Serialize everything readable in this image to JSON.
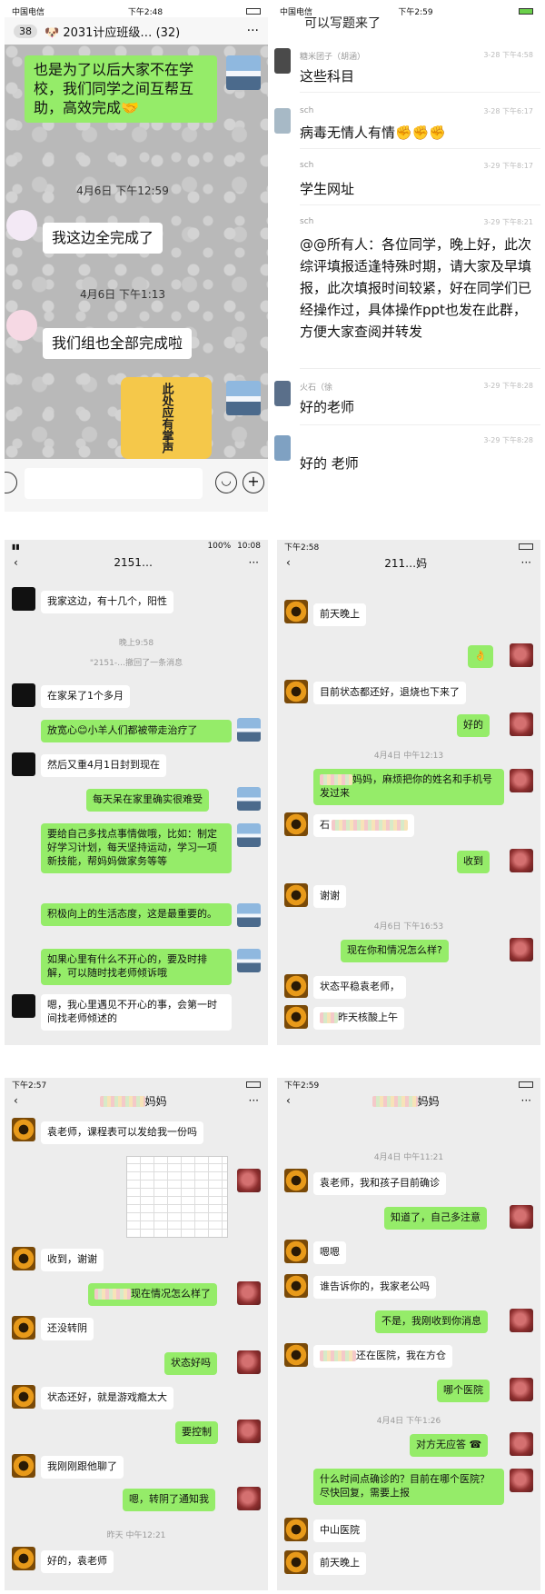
{
  "p1": {
    "status": {
      "carrier": "中国电信",
      "time": "下午2:48"
    },
    "header": {
      "badge": "38",
      "title": "2031计应班级…",
      "count": "(32)",
      "more": "···"
    },
    "msgs": [
      {
        "text": "也是为了以后大家不在学校，我们同学之间互帮互助，高效完成🤝"
      },
      {
        "time": "4月6日 下午12:59"
      },
      {
        "text": "我这边全完成了"
      },
      {
        "time": "4月6日 下午1:13"
      },
      {
        "text": "我们组也全部完成啦"
      }
    ],
    "sticker_text": "此处应有掌声"
  },
  "p2": {
    "status": {
      "carrier": "中国电信",
      "time": "下午2:59"
    },
    "top_cut": "可以写题来了",
    "msgs": [
      {
        "name": "糖米团子（胡涵）",
        "time": "3-28 下午4:58",
        "text": "这些科目"
      },
      {
        "name": "sch",
        "time": "3-28 下午6:17",
        "text": "病毒无情人有情✊✊✊"
      },
      {
        "name": "sch",
        "time": "3-29 下午8:17",
        "text": "学生网址"
      },
      {
        "name": "sch",
        "time": "3-29 下午8:21",
        "text": "@@所有人：各位同学，晚上好，此次综评填报适逢特殊时期，请大家及早填报，此次填报时间较紧，好在同学们已经操作过，具体操作ppt也发在此群，方便大家查阅并转发"
      },
      {
        "name": "火石（徐",
        "time": "3-29 下午8:28",
        "text": "好的老师"
      },
      {
        "name": "",
        "time": "3-29 下午8:28",
        "text": "好的 老师"
      }
    ]
  },
  "p3": {
    "status": {
      "time": "10:08",
      "battery": "100%"
    },
    "header": {
      "title": "2151…"
    },
    "msgs": [
      {
        "text": "我家这边，有十几个，阳性"
      },
      {
        "time": "晚上9:58"
      },
      {
        "notice": "\"2151-…撤回了一条消息"
      },
      {
        "text": "在家呆了1个多月"
      },
      {
        "text": "放宽心😊小羊人们都被带走治疗了"
      },
      {
        "text": "然后又重4月1日封到现在"
      },
      {
        "text": "每天呆在家里确实很难受"
      },
      {
        "text": "要给自己多找点事情做哦，比如：制定好学习计划，每天坚持运动，学习一项新技能，帮妈妈做家务等等"
      },
      {
        "text": "积极向上的生活态度，这是最重要的。"
      },
      {
        "text": "如果心里有什么不开心的，要及时排解，可以随时找老师倾诉哦"
      },
      {
        "text": "嗯，我心里遇见不开心的事，会第一时间找老师倾述的"
      }
    ]
  },
  "p4": {
    "status": {
      "time": "下午2:58"
    },
    "header": {
      "title": "211…妈"
    },
    "msgs": [
      {
        "text": "前天晚上"
      },
      {
        "text": "👌"
      },
      {
        "text": "目前状态都还好，退烧也下来了"
      },
      {
        "text": "好的"
      },
      {
        "time": "4月4日 中午12:13"
      },
      {
        "text": "妈妈，麻烦把你的姓名和手机号发过来"
      },
      {
        "text": "石"
      },
      {
        "text": "收到"
      },
      {
        "text": "谢谢"
      },
      {
        "time": "4月6日 下午16:53"
      },
      {
        "text": "现在你和情况怎么样?"
      },
      {
        "text": "状态平稳袁老师，"
      },
      {
        "text": "昨天核酸上午"
      }
    ]
  },
  "p5": {
    "status": {
      "time": "下午2:57"
    },
    "header": {
      "title": "妈妈"
    },
    "msgs": [
      {
        "text": "袁老师，课程表可以发给我一份吗"
      },
      {
        "text": "收到，谢谢"
      },
      {
        "text": "现在情况怎么样了"
      },
      {
        "text": "还没转阴"
      },
      {
        "text": "状态好吗"
      },
      {
        "text": "状态还好，就是游戏瘾太大"
      },
      {
        "text": "要控制"
      },
      {
        "text": "我刚刚跟他聊了"
      },
      {
        "text": "嗯，转阴了通知我"
      },
      {
        "time": "昨天 中午12:21"
      },
      {
        "text": "好的，袁老师"
      }
    ]
  },
  "p6": {
    "status": {
      "time": "下午2:59"
    },
    "header": {
      "title": "妈妈"
    },
    "msgs": [
      {
        "time": "4月4日 中午11:21"
      },
      {
        "text": "袁老师，我和孩子目前确诊"
      },
      {
        "text": "知道了，自己多注意"
      },
      {
        "text": "嗯嗯"
      },
      {
        "text": "谁告诉你的，我家老公吗"
      },
      {
        "text": "不是，我刚收到你消息"
      },
      {
        "text": "还在医院，我在方仓"
      },
      {
        "text": "哪个医院"
      },
      {
        "time": "4月4日 下午1:26"
      },
      {
        "text": "对方无应答"
      },
      {
        "text": "什么时间点确诊的？目前在哪个医院？尽快回复，需要上报"
      },
      {
        "text": "中山医院"
      },
      {
        "text": "前天晚上"
      }
    ]
  }
}
